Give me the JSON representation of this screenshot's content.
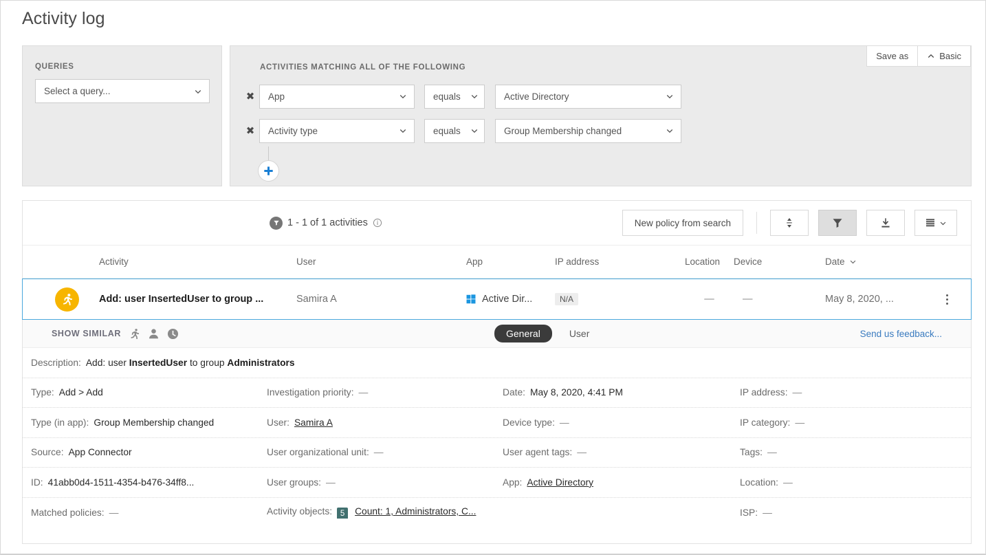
{
  "page": {
    "title": "Activity log"
  },
  "queries": {
    "label": "QUERIES",
    "select_value": "Select a query..."
  },
  "conditions": {
    "label": "ACTIVITIES MATCHING ALL OF THE FOLLOWING",
    "rows": [
      {
        "field": "App",
        "operator": "equals",
        "value": "Active Directory"
      },
      {
        "field": "Activity type",
        "operator": "equals",
        "value": "Group Membership changed"
      }
    ],
    "add_label": "+"
  },
  "top_buttons": {
    "save_as": "Save as",
    "basic": "Basic"
  },
  "toolbar": {
    "count_text": "1 - 1 of 1 activities",
    "new_policy": "New policy from search",
    "sort_icon": "sort-icon",
    "filter_icon": "filter-icon",
    "export_icon": "export-icon",
    "view_icon": "list-view-icon"
  },
  "table": {
    "headers": [
      "Activity",
      "User",
      "App",
      "IP address",
      "Location",
      "Device",
      "Date"
    ],
    "sorted_column": "Date",
    "row": {
      "activity": "Add: user InsertedUser to group ...",
      "user": "Samira A",
      "app": "Active Dir...",
      "ip": "N/A",
      "location": "—",
      "device": "—",
      "date": "May 8, 2020, ..."
    }
  },
  "detail_bar": {
    "show_similar": "SHOW SIMILAR",
    "icons": [
      "activity-icon",
      "user-icon",
      "clock-icon"
    ],
    "tabs": [
      {
        "label": "General",
        "active": true
      },
      {
        "label": "User",
        "active": false
      }
    ],
    "feedback": "Send us feedback..."
  },
  "details": {
    "description": {
      "label": "Description:",
      "prefix": "Add: user ",
      "bold1": "InsertedUser",
      "middle": " to group ",
      "bold2": "Administrators"
    },
    "rows": [
      [
        {
          "label": "Type:",
          "value": "Add > Add"
        },
        {
          "label": "Investigation priority:",
          "value": "—",
          "dash": true
        },
        {
          "label": "Date:",
          "value": "May 8, 2020, 4:41 PM"
        },
        {
          "label": "IP address:",
          "value": "—",
          "dash": true
        }
      ],
      [
        {
          "label": "Type (in app):",
          "value": "Group Membership changed"
        },
        {
          "label": "User:",
          "value": "Samira A",
          "link": true
        },
        {
          "label": "Device type:",
          "value": "—",
          "dash": true
        },
        {
          "label": "IP category:",
          "value": "—",
          "dash": true
        }
      ],
      [
        {
          "label": "Source:",
          "value": "App Connector"
        },
        {
          "label": "User organizational unit:",
          "value": "—",
          "dash": true
        },
        {
          "label": "User agent tags:",
          "value": "—",
          "dash": true
        },
        {
          "label": "Tags:",
          "value": "—",
          "dash": true
        }
      ],
      [
        {
          "label": "ID:",
          "value": "41abb0d4-1511-4354-b476-34ff8..."
        },
        {
          "label": "User groups:",
          "value": "—",
          "dash": true
        },
        {
          "label": "App:",
          "value": "Active Directory",
          "link": true
        },
        {
          "label": "Location:",
          "value": "—",
          "dash": true
        }
      ],
      [
        {
          "label": "Matched policies:",
          "value": "—",
          "dash": true
        },
        {
          "label": "Activity objects:",
          "value": "Count: 1, Administrators, C...",
          "link": true,
          "badge": "5"
        },
        {
          "label": "",
          "value": ""
        },
        {
          "label": "ISP:",
          "value": "—",
          "dash": true
        }
      ]
    ]
  }
}
